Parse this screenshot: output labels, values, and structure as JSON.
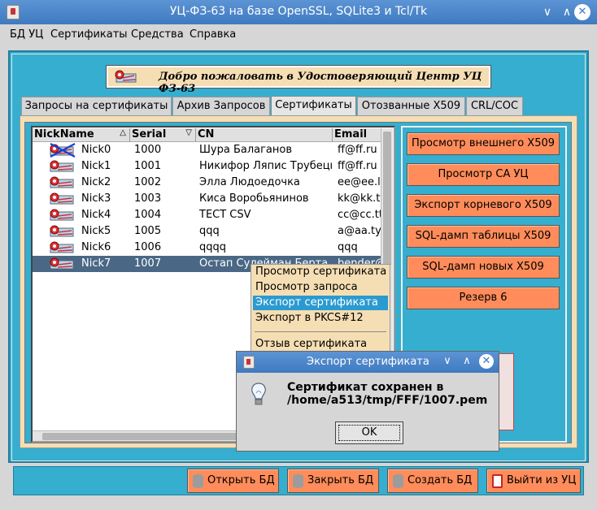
{
  "window": {
    "title": "УЦ-ФЗ-63 на базе OpenSSL, SQLite3 и Tcl/Tk",
    "minimize": "∨",
    "maximize": "∧",
    "close": "✕"
  },
  "menu": [
    "БД УЦ",
    "Сертификаты",
    "Средства",
    "Справка"
  ],
  "welcome": "Добро пожаловать в Удостоверяющий Центр УЦ ФЗ-63",
  "tabs": [
    "Запросы на сертификаты",
    "Архив Запросов",
    "Сертификаты",
    "Отозванные X509",
    "CRL/COC"
  ],
  "active_tab": "Сертификаты",
  "table": {
    "headers": [
      "NickName",
      "Serial",
      "CN",
      "Email"
    ],
    "sort_marks": [
      "△",
      "▽"
    ],
    "rows": [
      {
        "nick": "Nick0",
        "serial": "1000",
        "cn": "Шура Балаганов",
        "email": "ff@ff.ru",
        "revoked": true
      },
      {
        "nick": "Nick1",
        "serial": "1001",
        "cn": "Никифор Ляпис Трубецкой",
        "email": "ff@ff.ru",
        "revoked": false
      },
      {
        "nick": "Nick2",
        "serial": "1002",
        "cn": "Элла Людоедочка",
        "email": "ee@ee.ll",
        "revoked": false
      },
      {
        "nick": "Nick3",
        "serial": "1003",
        "cn": "Киса Воробьянинов",
        "email": "kk@kk.tt",
        "revoked": false
      },
      {
        "nick": "Nick4",
        "serial": "1004",
        "cn": "TECT CSV",
        "email": "cc@cc.tt",
        "revoked": false
      },
      {
        "nick": "Nick5",
        "serial": "1005",
        "cn": "qqq",
        "email": "a@aa.ty",
        "revoked": false
      },
      {
        "nick": "Nick6",
        "serial": "1006",
        "cn": "qqqq",
        "email": "qqq",
        "revoked": false
      },
      {
        "nick": "Nick7",
        "serial": "1007",
        "cn": "Остап Сулейман Берта",
        "email": "bender@",
        "revoked": false
      }
    ],
    "selected_row": 7
  },
  "context_menu": [
    "Просмотр сертификата",
    "Просмотр запроса",
    "Экспорт сертификата",
    "Экспорт в PKCS#12",
    "Отзыв сертификата"
  ],
  "context_highlight": 2,
  "actions": [
    "Просмотр внешнего X509",
    "Просмотр CA УЦ",
    "Экспорт корневого X509",
    "SQL-дамп таблицы X509",
    "SQL-дамп новых X509",
    "Резерв 6"
  ],
  "dialog": {
    "title": "Экспорт сертификата",
    "line1": "Сертификат сохранен в",
    "line2": "/home/a513/tmp/FFF/1007.pem",
    "ok": "OK"
  },
  "bottom_buttons": [
    "Открыть БД",
    "Закрыть БД",
    "Создать БД",
    "Выйти из УЦ"
  ],
  "colors": {
    "frame": "#35aecf",
    "panel": "#f5deb3",
    "button": "#ff8c5a",
    "selection": "#4a6885",
    "titlebar": "#4a86c8"
  }
}
